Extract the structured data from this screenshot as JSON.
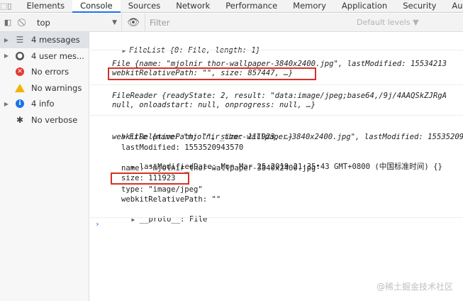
{
  "tabs": [
    "Elements",
    "Console",
    "Sources",
    "Network",
    "Performance",
    "Memory",
    "Application",
    "Security",
    "Aud"
  ],
  "active_tab": "Console",
  "toolbar": {
    "context": "top",
    "filter_placeholder": "Filter",
    "levels": "Default levels ▼"
  },
  "sidebar": {
    "items": [
      {
        "label": "4 messages",
        "icon": "list-icon"
      },
      {
        "label": "4 user mes...",
        "icon": "user-icon"
      },
      {
        "label": "No errors",
        "icon": "error-icon"
      },
      {
        "label": "No warnings",
        "icon": "warning-icon"
      },
      {
        "label": "4 info",
        "icon": "info-icon"
      },
      {
        "label": "No verbose",
        "icon": "bug-icon"
      }
    ]
  },
  "console": {
    "filelist": "FileList {0: File, length: 1}",
    "file1_line1": "File {name: \"mjolnir_thor-wallpaper-3840x2400.jpg\", lastModified: 15534213",
    "file1_line2": "webkitRelativePath: \"\", size: 857447, …}",
    "reader_line1": "FileReader {readyState: 2, result: \"data:image/jpeg;base64,/9j/4AAQSkZJRgA",
    "reader_line2": "null, onloadstart: null, onprogress: null, …}",
    "file2_line1": "File {name: \"mjolnir_thor-wallpaper-3840x2400.jpg\", lastModified: 15535209",
    "file2_line2": "webkitRelativePath: \"\", size: 111923, …}",
    "lastModified": "lastModified: 1553520943570",
    "lastModifiedDate": "lastModifiedDate: Mon Mar 25 2019 21:35:43 GMT+0800 (中国标准时间) {}",
    "name": "name: \"mjolnir_thor-wallpaper-3840x2400.jpg\"",
    "size": "size: 111923",
    "type": "type: \"image/jpeg\"",
    "webkitRelativePath": "webkitRelativePath: \"\"",
    "proto": "__proto__: File"
  },
  "watermark": "@稀土掘金技术社区",
  "colors": {
    "accent": "#1a73e8",
    "highlight": "#d93025"
  }
}
